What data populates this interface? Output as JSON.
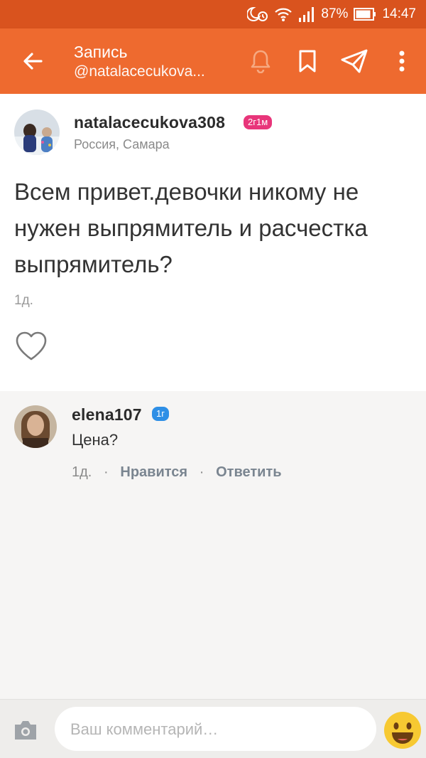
{
  "status_bar": {
    "battery": "87%",
    "time": "14:47"
  },
  "header": {
    "title": "Запись",
    "subtitle": "@natalacecukova..."
  },
  "post": {
    "username": "natalacecukova308",
    "badge": "2г1м",
    "location": "Россия, Самара",
    "text": "Всем привет.девочки никому не нужен выпрямитель и расчестка выпрямитель?",
    "time": "1д."
  },
  "comment": {
    "username": "elena107",
    "badge": "1г",
    "text": "Цена?",
    "time": "1д.",
    "like_label": "Нравится",
    "reply_label": "Ответить"
  },
  "composer": {
    "placeholder": "Ваш комментарий…"
  },
  "colors": {
    "accent": "#ee6a2f",
    "status_bar": "#d9531e",
    "badge_pink": "#e8357a",
    "badge_blue": "#2e8fe6"
  }
}
